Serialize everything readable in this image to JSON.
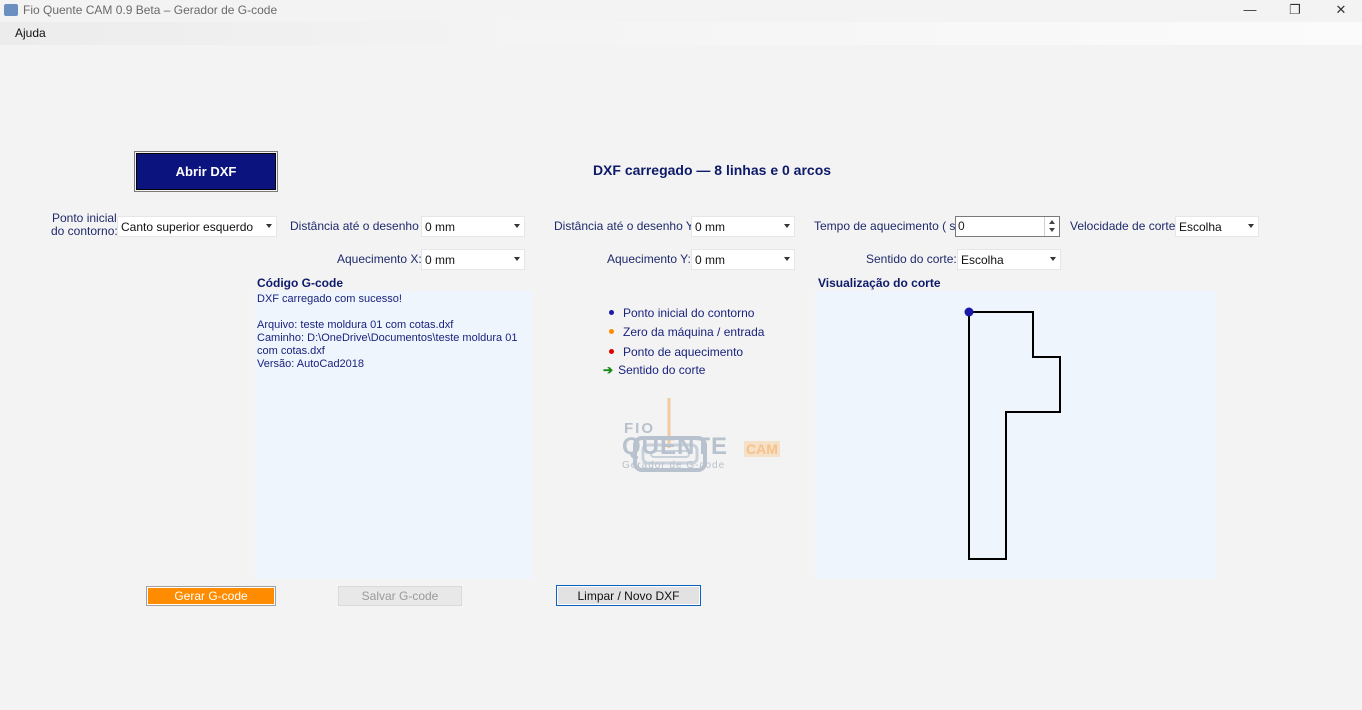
{
  "window": {
    "title": "Fio Quente CAM 0.9 Beta – Gerador de G-code",
    "minimize_glyph": "—",
    "maximize_glyph": "❐",
    "close_glyph": "✕"
  },
  "menu": {
    "help": "Ajuda"
  },
  "open_button": "Abrir DXF",
  "status": "DXF carregado — 8 linhas e 0 arcos",
  "form": {
    "start_point": {
      "label_line1": "Ponto inicial",
      "label_line2": "do contorno:",
      "value": "Canto superior esquerdo"
    },
    "dist_x": {
      "label": "Distância até o desenho X:",
      "value": "0 mm"
    },
    "dist_y": {
      "label": "Distância até o desenho Y:",
      "value": "0 mm"
    },
    "heat_time": {
      "label": "Tempo de aquecimento ( s ):",
      "value": "0"
    },
    "cut_speed": {
      "label": "Velocidade de corte:",
      "value": "Escolha"
    },
    "heat_x": {
      "label": "Aquecimento X:",
      "value": "0 mm"
    },
    "heat_y": {
      "label": "Aquecimento Y:",
      "value": "0 mm"
    },
    "cut_direction": {
      "label": "Sentido do corte:",
      "value": "Escolha"
    }
  },
  "gcode": {
    "title": "Código G-code",
    "text": "DXF carregado com sucesso!\n\nArquivo: teste moldura 01 com cotas.dxf\nCaminho: D:\\OneDrive\\Documentos\\teste moldura 01\ncom cotas.dxf\nVersão: AutoCad2018"
  },
  "legend": [
    {
      "label": "Ponto inicial do contorno",
      "color": "#1a1aa6",
      "icon": "dot-icon"
    },
    {
      "label": "Zero da máquina / entrada",
      "color": "#ff8c00",
      "icon": "dot-icon"
    },
    {
      "label": "Ponto de aquecimento",
      "color": "#e00000",
      "icon": "dot-icon"
    },
    {
      "label": "Sentido do corte",
      "color": "#1a8a1a",
      "icon": "arrow-right-icon"
    }
  ],
  "logo": {
    "line1": "FIO",
    "line2": "QUENTE",
    "badge": "CAM",
    "sub": "Gerador de G-code"
  },
  "visualization": {
    "title": "Visualização do corte"
  },
  "buttons": {
    "generate": "Gerar G-code",
    "save": "Salvar G-code",
    "clear": "Limpar / Novo DXF"
  },
  "colors": {
    "accent_navy": "#0b137f",
    "orange": "#ff8c00",
    "panel_bg": "#eef5fd"
  }
}
